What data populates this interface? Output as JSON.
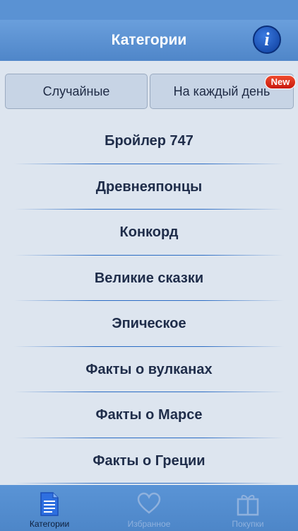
{
  "header": {
    "title": "Категории",
    "info_label": "i"
  },
  "segments": {
    "random_label": "Случайные",
    "daily_label": "На каждый день",
    "new_badge": "New"
  },
  "categories": [
    "Бройлер 747",
    "Древнеяпонцы",
    "Конкорд",
    "Великие сказки",
    "Эпическое",
    "Факты о вулканах",
    "Факты о Марсе",
    "Факты о Греции"
  ],
  "tabs": [
    {
      "label": "Категории",
      "icon": "document-icon",
      "active": true
    },
    {
      "label": "Избранное",
      "icon": "heart-icon",
      "active": false
    },
    {
      "label": "Покупки",
      "icon": "gift-icon",
      "active": false
    }
  ],
  "colors": {
    "accent": "#4f86c9",
    "badge": "#d9261a",
    "active_tab": "#0e1f3c",
    "inactive_tab": "#8fb1dd"
  }
}
